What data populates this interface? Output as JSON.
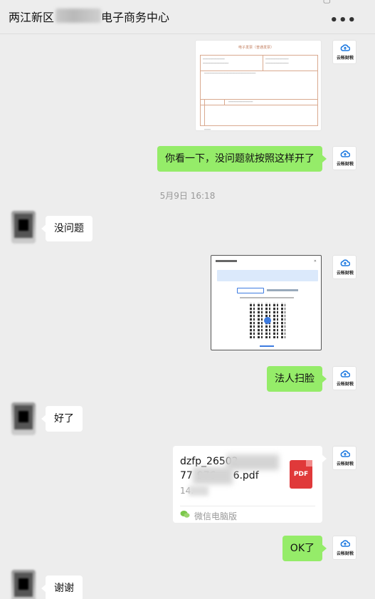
{
  "header": {
    "title_prefix": "两江新区",
    "title_suffix": "电子商务中心",
    "more_label": "•••"
  },
  "mine_avatar": {
    "caption": "云帐财税",
    "icon": "cloud-upload-icon"
  },
  "messages": [
    {
      "id": "m1",
      "side": "right",
      "type": "image",
      "content": "invoice-preview",
      "invoice_title": "电子发票（普通发票）"
    },
    {
      "id": "m2",
      "side": "right",
      "type": "text",
      "text": "你看一下，没问题就按照这样开了"
    },
    {
      "id": "m3",
      "side": "left",
      "type": "text",
      "text": "没问题"
    },
    {
      "id": "m4",
      "side": "right",
      "type": "image",
      "content": "qr-scan-dialog"
    },
    {
      "id": "m5",
      "side": "right",
      "type": "text",
      "text": "法人扫脸"
    },
    {
      "id": "m6",
      "side": "left",
      "type": "text",
      "text": "好了"
    },
    {
      "id": "m7",
      "side": "right",
      "type": "file",
      "name_line1": "dzfp_26502",
      "name_line2": "77",
      "name_tail": "6.pdf",
      "name_mid": "976",
      "size": "14.",
      "badge": "PDF",
      "source": "微信电脑版"
    },
    {
      "id": "m8",
      "side": "right",
      "type": "text",
      "text": "OK了"
    },
    {
      "id": "m9",
      "side": "left",
      "type": "text",
      "text": "谢谢"
    }
  ],
  "timestamp": "5月9日 16:18",
  "colors": {
    "background": "#ededed",
    "bubble_mine": "#95ec69",
    "bubble_other": "#ffffff",
    "pdf_badge": "#e0393a",
    "cloud_icon": "#1f7ae0"
  }
}
